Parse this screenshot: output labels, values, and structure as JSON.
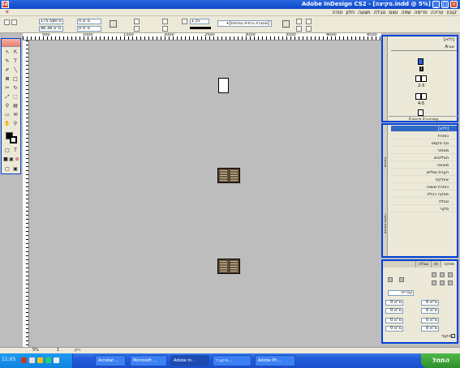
{
  "window": {
    "title": "Adobe InDesign CS2 - [סקיצה.indd @ 5%]",
    "app_icon_label": "Id",
    "minimize": "_",
    "maximize": "□",
    "close": "×"
  },
  "menubar": {
    "items": [
      "קובץ",
      "עריכה",
      "פריסה",
      "שפה",
      "עצם",
      "טבלה",
      "תצוגה",
      "חלון",
      "עזרה"
    ]
  },
  "controlbar": {
    "x_field": "175.5p0 מ\"מ",
    "y_field": "96.36 מ\"מ",
    "w_field": "0 מ\"מ",
    "h_field": "0 מ\"מ",
    "stroke_weight": "1 נק'",
    "style_field": "[מסגרת גרפית בסיסית]+"
  },
  "ruler": {
    "labels": [
      "500",
      "1000",
      "1500",
      "2000",
      "2500",
      "3000",
      "3500",
      "4000",
      "4500"
    ]
  },
  "pages_panel": {
    "header": "[ללא]",
    "master_label": "A-אב",
    "labels": [
      "1",
      "2-3",
      "4-5"
    ],
    "footer": "4 עמודים ב-3 פריסות"
  },
  "styles_panel": {
    "header": "[ללא]",
    "items": [
      "[ללא]",
      "כותרת",
      "גוף טקסט",
      "מספור",
      "תבליטים",
      "מובאה",
      "הערת שוליים",
      "אינדקס",
      "כותרת משנה",
      "פסקה רגילה",
      "טבלה",
      "מקור"
    ],
    "side_tabs": [
      "סגנונות",
      "סגנונות פסקה"
    ]
  },
  "paragraph_panel": {
    "tabs": [
      "פסקה",
      "תו",
      "טבלה"
    ],
    "language": "עברית",
    "values": [
      "0 מ\"מ",
      "0 מ\"מ",
      "0 מ\"מ",
      "0 מ\"מ",
      "0 מ\"מ",
      "0 מ\"מ",
      "0 מ\"מ",
      "0 מ\"מ"
    ],
    "hyphenate_label": "מיקוף"
  },
  "statusbar": {
    "zoom": "5%",
    "page": "1",
    "status": "ריק"
  },
  "taskbar": {
    "time": "11:05",
    "start": "התחל",
    "tasks": [
      "Adobe Ph...",
      "תיקון ד...",
      "Adobe In...",
      "Microsoft ...",
      "Acrobat ..."
    ]
  }
}
